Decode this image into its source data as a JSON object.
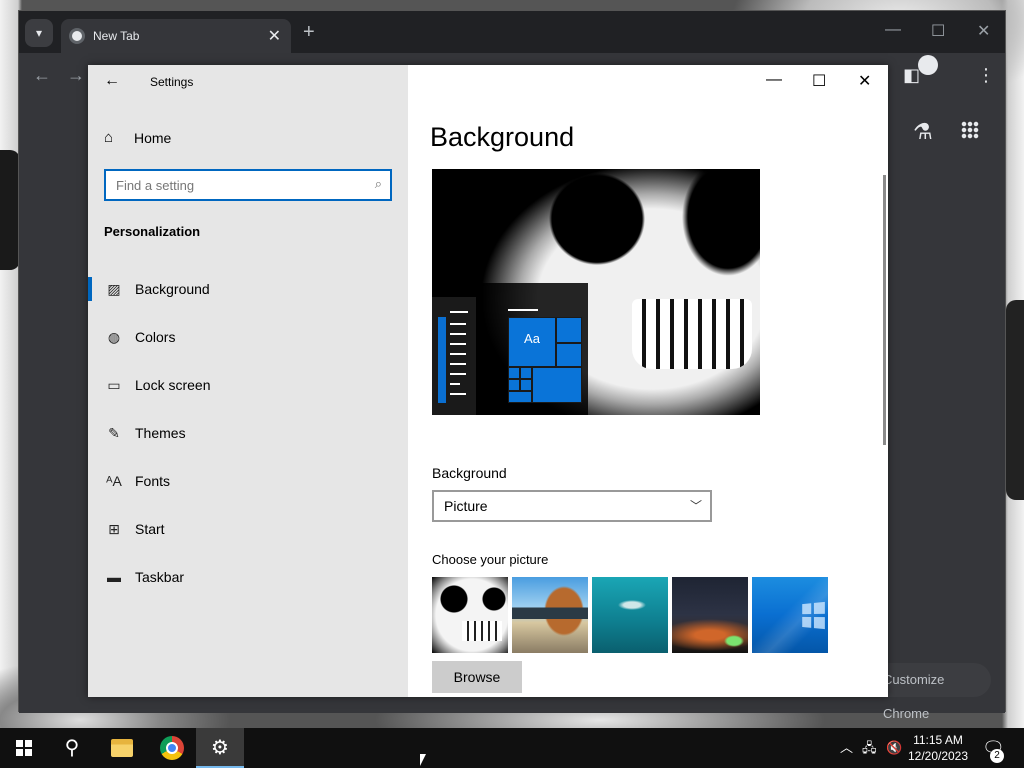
{
  "chrome": {
    "tab_title": "New Tab",
    "tab_close": "✕",
    "new_tab": "+",
    "customize_label": "Customize Chrome"
  },
  "settings": {
    "window_title": "Settings",
    "home_label": "Home",
    "search_placeholder": "Find a setting",
    "section_title": "Personalization",
    "nav_items": [
      {
        "label": "Background",
        "icon": "picture-icon",
        "active": true
      },
      {
        "label": "Colors",
        "icon": "palette-icon",
        "active": false
      },
      {
        "label": "Lock screen",
        "icon": "lock-screen-icon",
        "active": false
      },
      {
        "label": "Themes",
        "icon": "themes-icon",
        "active": false
      },
      {
        "label": "Fonts",
        "icon": "fonts-icon",
        "active": false
      },
      {
        "label": "Start",
        "icon": "start-icon",
        "active": false
      },
      {
        "label": "Taskbar",
        "icon": "taskbar-icon",
        "active": false
      }
    ],
    "page_heading": "Background",
    "preview_tile_text": "Aa",
    "background_label": "Background",
    "background_value": "Picture",
    "choose_label": "Choose your picture",
    "browse_label": "Browse"
  },
  "taskbar": {
    "time": "11:15 AM",
    "date": "12/20/2023",
    "notification_count": "2"
  },
  "colors": {
    "accent": "#0067c0",
    "sidebar_bg": "#e6e6e6",
    "chrome_bg": "#35363a",
    "taskbar_bg": "#101010"
  }
}
